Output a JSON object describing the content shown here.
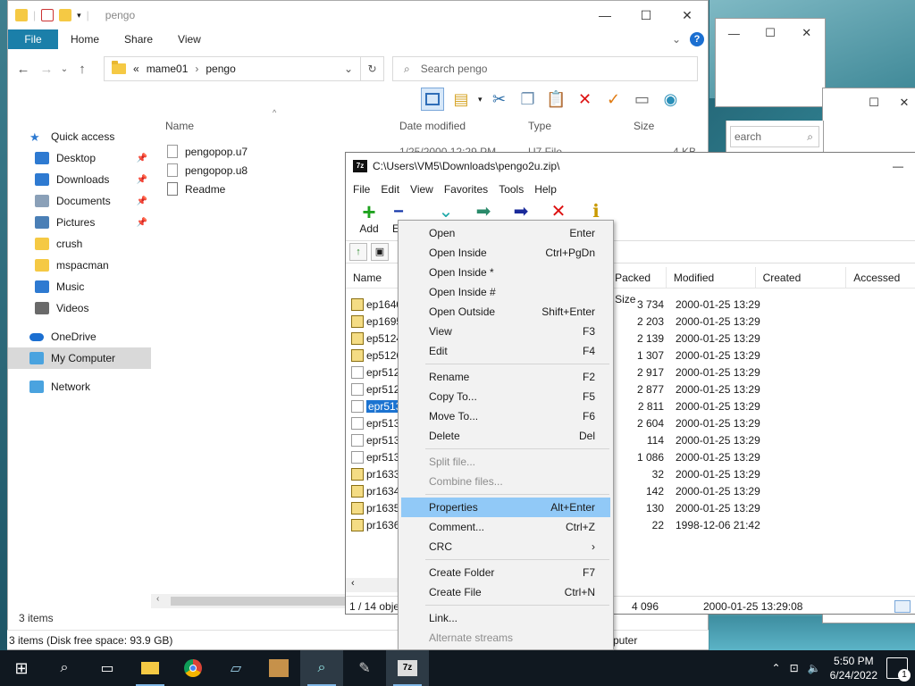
{
  "explorer": {
    "title": "pengo",
    "tabs": [
      "File",
      "Home",
      "Share",
      "View"
    ],
    "address": {
      "prefix": "«",
      "segments": [
        "mame01",
        "pengo"
      ]
    },
    "search_placeholder": "Search pengo",
    "columns": [
      "Name",
      "Date modified",
      "Type",
      "Size"
    ],
    "files": [
      {
        "name": "pengopop.u7",
        "date": "1/25/2000 12:29 PM",
        "type": "U7 File",
        "size": "4 KB"
      },
      {
        "name": "pengopop.u8"
      },
      {
        "name": "Readme"
      }
    ],
    "nav": [
      {
        "label": "Quick access",
        "icon": "star-icon",
        "pinned": false
      },
      {
        "label": "Desktop",
        "icon": "desktop-icon",
        "pinned": true
      },
      {
        "label": "Downloads",
        "icon": "download-icon",
        "pinned": true
      },
      {
        "label": "Documents",
        "icon": "documents-icon",
        "pinned": true
      },
      {
        "label": "Pictures",
        "icon": "pictures-icon",
        "pinned": true
      },
      {
        "label": "crush",
        "icon": "folder-icon",
        "pinned": false
      },
      {
        "label": "mspacman",
        "icon": "folder-icon",
        "pinned": false
      },
      {
        "label": "Music",
        "icon": "music-icon",
        "pinned": false
      },
      {
        "label": "Videos",
        "icon": "videos-icon",
        "pinned": false
      },
      {
        "label": "OneDrive",
        "icon": "cloud-icon",
        "pinned": false
      },
      {
        "label": "My Computer",
        "icon": "computer-icon",
        "pinned": false,
        "selected": true
      },
      {
        "label": "Network",
        "icon": "network-icon",
        "pinned": false
      }
    ],
    "item_count": "3 items",
    "status": "3 items (Disk free space: 93.9 GB)",
    "bg_search_fragment": "earch",
    "bg_status_fragment": "puter"
  },
  "zip": {
    "title": "C:\\Users\\VM5\\Downloads\\pengo2u.zip\\",
    "menu": [
      "File",
      "Edit",
      "View",
      "Favorites",
      "Tools",
      "Help"
    ],
    "tools": [
      {
        "label": "Add",
        "icon": "add-icon",
        "glyph": "+"
      },
      {
        "label": "Ex",
        "icon": "extract-icon",
        "glyph": "−"
      }
    ],
    "columns": [
      "Name",
      "Packed Size",
      "Modified",
      "Created",
      "Accessed"
    ],
    "rows": [
      {
        "name": "ep1640",
        "packed": "3 734",
        "modified": "2000-01-25 13:29",
        "rom": true
      },
      {
        "name": "ep1695",
        "packed": "2 203",
        "modified": "2000-01-25 13:29",
        "rom": true
      },
      {
        "name": "ep5124",
        "packed": "2 139",
        "modified": "2000-01-25 13:29",
        "rom": true
      },
      {
        "name": "ep5126",
        "packed": "1 307",
        "modified": "2000-01-25 13:29",
        "rom": true
      },
      {
        "name": "epr512",
        "packed": "2 917",
        "modified": "2000-01-25 13:29",
        "rom": false
      },
      {
        "name": "epr512",
        "packed": "2 877",
        "modified": "2000-01-25 13:29",
        "rom": false
      },
      {
        "name": "epr513",
        "packed": "2 811",
        "modified": "2000-01-25 13:29",
        "rom": false,
        "selected": true
      },
      {
        "name": "epr513",
        "packed": "2 604",
        "modified": "2000-01-25 13:29",
        "rom": false
      },
      {
        "name": "epr513",
        "packed": "114",
        "modified": "2000-01-25 13:29",
        "rom": false
      },
      {
        "name": "epr513",
        "packed": "1 086",
        "modified": "2000-01-25 13:29",
        "rom": false
      },
      {
        "name": "pr1633",
        "packed": "32",
        "modified": "2000-01-25 13:29",
        "rom": true
      },
      {
        "name": "pr1634",
        "packed": "142",
        "modified": "2000-01-25 13:29",
        "rom": true
      },
      {
        "name": "pr1635",
        "packed": "130",
        "modified": "2000-01-25 13:29",
        "rom": true
      },
      {
        "name": "pr1636",
        "packed": "22",
        "modified": "1998-12-06 21:42",
        "rom": true
      }
    ],
    "status": [
      "1 / 14 obje",
      "4 096",
      "2000-01-25 13:29:08"
    ]
  },
  "context_menu": [
    {
      "label": "Open",
      "shortcut": "Enter"
    },
    {
      "label": "Open Inside",
      "shortcut": "Ctrl+PgDn"
    },
    {
      "label": "Open Inside *",
      "shortcut": ""
    },
    {
      "label": "Open Inside #",
      "shortcut": ""
    },
    {
      "label": "Open Outside",
      "shortcut": "Shift+Enter"
    },
    {
      "label": "View",
      "shortcut": "F3"
    },
    {
      "label": "Edit",
      "shortcut": "F4"
    },
    {
      "sep": true
    },
    {
      "label": "Rename",
      "shortcut": "F2"
    },
    {
      "label": "Copy To...",
      "shortcut": "F5"
    },
    {
      "label": "Move To...",
      "shortcut": "F6"
    },
    {
      "label": "Delete",
      "shortcut": "Del"
    },
    {
      "sep": true
    },
    {
      "label": "Split file...",
      "shortcut": "",
      "disabled": true
    },
    {
      "label": "Combine files...",
      "shortcut": "",
      "disabled": true
    },
    {
      "sep": true
    },
    {
      "label": "Properties",
      "shortcut": "Alt+Enter",
      "highlighted": true
    },
    {
      "label": "Comment...",
      "shortcut": "Ctrl+Z"
    },
    {
      "label": "CRC",
      "shortcut": "›"
    },
    {
      "sep": true
    },
    {
      "label": "Create Folder",
      "shortcut": "F7"
    },
    {
      "label": "Create File",
      "shortcut": "Ctrl+N"
    },
    {
      "sep": true
    },
    {
      "label": "Link...",
      "shortcut": ""
    },
    {
      "label": "Alternate streams",
      "shortcut": "",
      "disabled": true
    }
  ],
  "taskbar": {
    "time": "5:50 PM",
    "date": "6/24/2022",
    "notifications": "1",
    "apps": [
      "start-icon",
      "search-icon",
      "task-view-icon",
      "file-explorer-icon",
      "chrome-icon",
      "notepad-icon",
      "dosbox-icon",
      "search-app-icon",
      "paint-icon",
      "7zip-icon"
    ]
  },
  "colors": {
    "accent": "#1b7fa9",
    "selection": "#1b73d1",
    "menu_highlight": "#91c9f7",
    "taskbar": "#101820"
  }
}
